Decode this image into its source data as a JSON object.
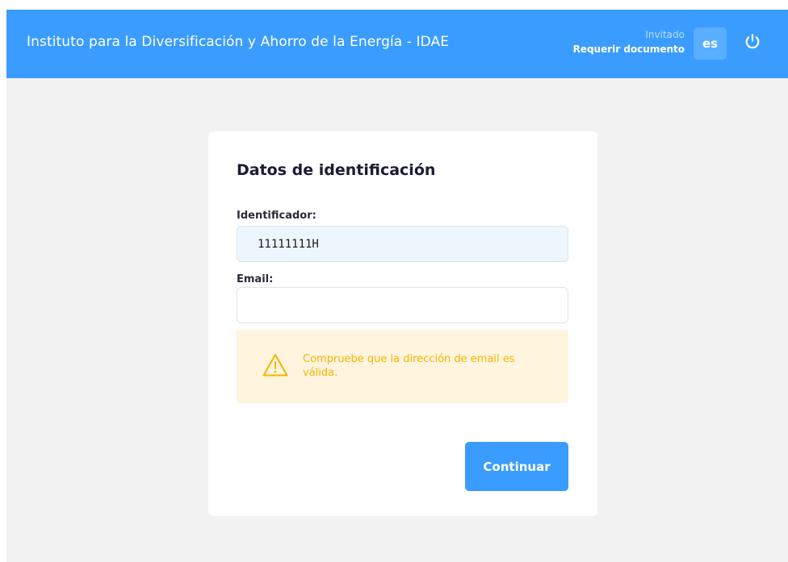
{
  "header": {
    "title": "Instituto para la Diversificación y Ahorro de la Energía - IDAE",
    "user_role": "Invitado",
    "user_action": "Requerir documento",
    "language": "es",
    "power_icon": "power-icon"
  },
  "form": {
    "title": "Datos de identificación",
    "identifier_label": "Identificador:",
    "identifier_value": "11111111H",
    "email_label": "Email:",
    "email_value": "",
    "email_placeholder": "",
    "alert_icon": "warning-icon",
    "alert_text": "Compruebe que la dirección de email es válida.",
    "submit_label": "Continuar"
  },
  "colors": {
    "primary": "#3b9cff",
    "background": "#f2f2f2",
    "alert_background": "#fff4de",
    "alert_text": "#f5b400",
    "identifier_field_background": "#eef6fd"
  }
}
